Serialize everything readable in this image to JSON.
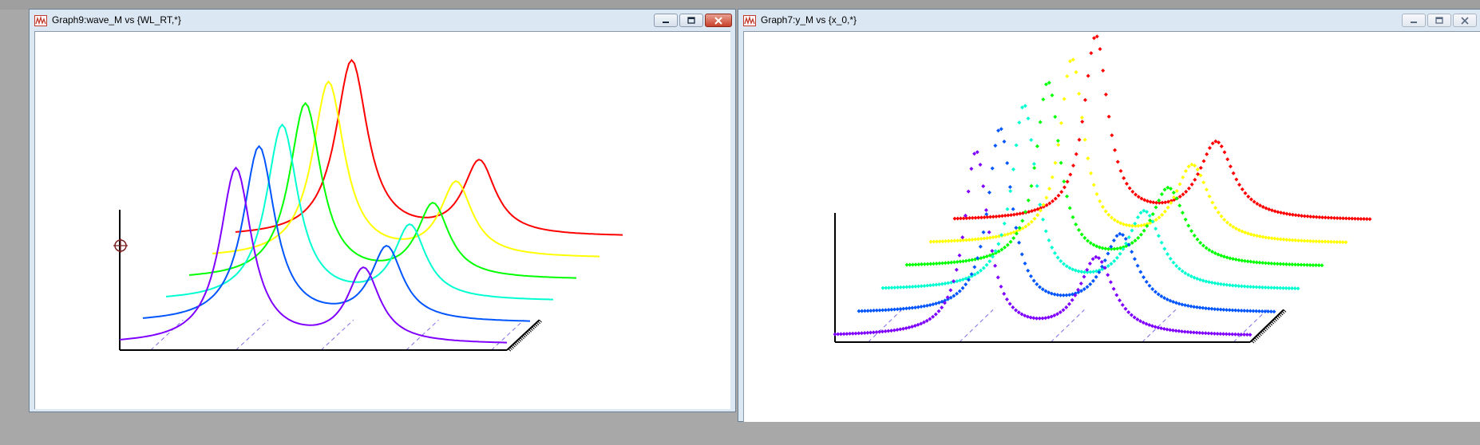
{
  "windows": {
    "left": {
      "title": "Graph9:wave_M vs {WL_RT,*}"
    },
    "right": {
      "title": "Graph7:y_M vs {x_0,*}"
    }
  },
  "caption_buttons": {
    "minimize": "minimize-icon",
    "maximize": "maximize-icon",
    "close": "close-icon"
  },
  "colors": {
    "axis": "#000000",
    "grid": "#7b70e6",
    "cursor": "#7a1f1f",
    "series": [
      "#7f00ff",
      "#0055ff",
      "#00ffd0",
      "#00ff00",
      "#ffff00",
      "#ff0000"
    ]
  },
  "chart_data": [
    {
      "type": "line",
      "style": "waterfall",
      "x_range": [
        0,
        1
      ],
      "y_range": [
        0,
        1
      ],
      "series_count": 6,
      "peaks": [
        [
          0.3,
          0.05,
          1.0
        ],
        [
          0.63,
          0.05,
          0.42
        ]
      ],
      "baseline": 0.03,
      "grid": true,
      "cursor": true
    },
    {
      "type": "scatter",
      "style": "waterfall",
      "x_range": [
        0,
        1
      ],
      "y_range": [
        0,
        1
      ],
      "series_count": 6,
      "peaks": [
        [
          0.34,
          0.035,
          1.0
        ],
        [
          0.63,
          0.05,
          0.42
        ]
      ],
      "baseline": 0.03,
      "grid": true,
      "cursor": false
    }
  ]
}
